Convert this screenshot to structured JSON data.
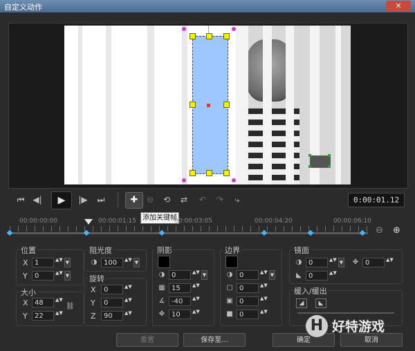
{
  "window": {
    "title": "自定义动作",
    "close_glyph": "✕"
  },
  "transport": {
    "go_start_icon": "⏮",
    "prev_frame_icon": "◀|",
    "play_icon": "▶",
    "next_frame_icon": "|▶",
    "go_end_icon": "⏭",
    "add_keyframe_icon": "✚",
    "remove_keyframe_icon": "⊖",
    "invert_icon": "⟲",
    "swap_icon": "⇄",
    "prev_kf_icon": "↶",
    "next_kf_icon": "↷",
    "copy_icon": "⤷",
    "timecode": "0:00:01.12"
  },
  "tooltip": "添加关键帧",
  "timeline": {
    "labels": [
      "00:00:00:00",
      "00:00:01:15",
      "00:00:03:05",
      "00:00:04:20",
      "00:00:06:10"
    ],
    "keyframes_fraction": [
      0.0,
      0.215,
      0.425,
      0.71,
      0.84,
      0.985
    ],
    "playhead_fraction": 0.22,
    "zoom_out_icon": "⊖",
    "zoom_in_icon": "⊕"
  },
  "position": {
    "title": "位置",
    "x_label": "X",
    "x": "1",
    "y_label": "Y",
    "y": "0"
  },
  "size": {
    "title": "大小",
    "x_label": "X",
    "x": "48",
    "y_label": "Y",
    "y": "22",
    "link_icon": "⛓"
  },
  "opacity": {
    "title": "阻光度",
    "value": "100"
  },
  "rotation": {
    "title": "旋转",
    "x_label": "X",
    "x": "0",
    "y_label": "Y",
    "y": "0",
    "z_label": "Z",
    "z": "90"
  },
  "shadow": {
    "title": "阴影",
    "opacity": "0",
    "blur": "15",
    "angle": "-40",
    "distance": "10"
  },
  "border": {
    "title": "边界",
    "width": "0",
    "val2": "0",
    "val3": "0",
    "val4": "0"
  },
  "mirror": {
    "title": "镜面",
    "opacity": "0",
    "offset": "0",
    "val": "0"
  },
  "fade": {
    "title": "缓入/缓出"
  },
  "buttons": {
    "reset": "重置",
    "save_to": "保存至...",
    "ok": "确定",
    "cancel": "取消"
  },
  "watermark": {
    "logo": "H",
    "text": "好特游戏"
  }
}
